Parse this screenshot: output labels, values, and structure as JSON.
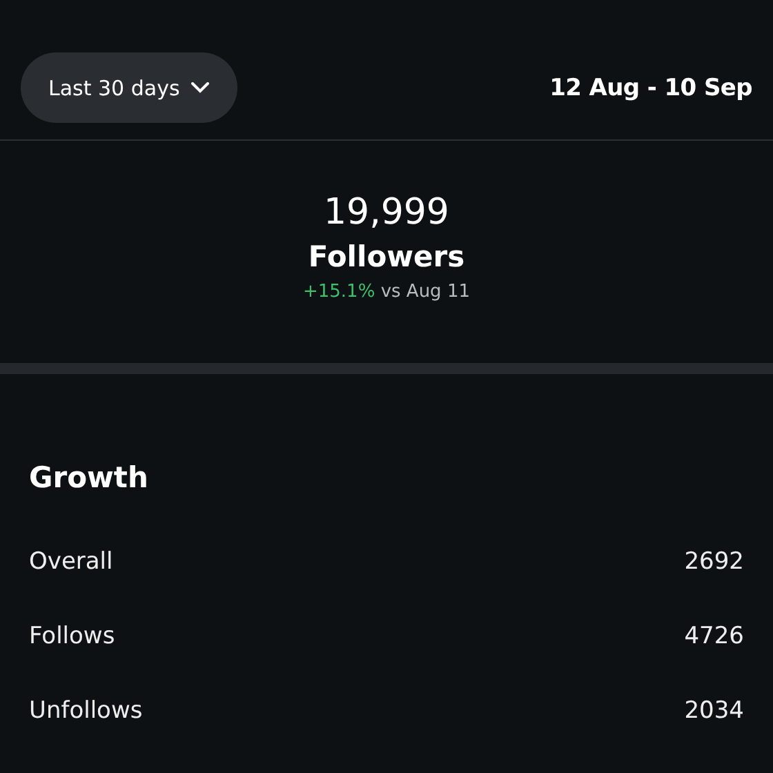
{
  "filter": {
    "range_button": "Last 30 days",
    "date_range": "12 Aug - 10 Sep"
  },
  "summary": {
    "value": "19,999",
    "label": "Followers",
    "change": "+15.1%",
    "comparison": "vs Aug 11",
    "positive": true
  },
  "growth": {
    "title": "Growth",
    "rows": [
      {
        "label": "Overall",
        "value": "2692"
      },
      {
        "label": "Follows",
        "value": "4726"
      },
      {
        "label": "Unfollows",
        "value": "2034"
      }
    ]
  }
}
